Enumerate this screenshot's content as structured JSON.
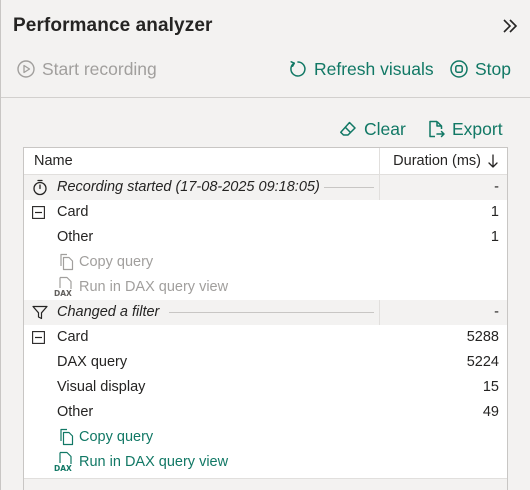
{
  "pane": {
    "title": "Performance analyzer",
    "collapse_icon": "chevron-double-right-icon"
  },
  "toolbar": {
    "start_recording": "Start recording",
    "refresh_visuals": "Refresh visuals",
    "stop": "Stop",
    "clear": "Clear",
    "export": "Export"
  },
  "colors": {
    "accent": "#117865",
    "disabled": "#a19f9d",
    "text": "#252423",
    "pane_bg": "#f3f2f1"
  },
  "table": {
    "columns": {
      "name": "Name",
      "duration": "Duration (ms)"
    },
    "sort": "descending",
    "rows": [
      {
        "type": "event",
        "icon": "stopwatch-icon",
        "label": "Recording started (17-08-2025 09:18:05)",
        "value": "-"
      },
      {
        "type": "visual",
        "icon": "collapse-box-icon",
        "label": "Card",
        "value": "1"
      },
      {
        "type": "metric",
        "label": "Other",
        "value": "1"
      },
      {
        "type": "link",
        "icon": "copy-icon",
        "label": "Copy query",
        "state": "disabled"
      },
      {
        "type": "link",
        "icon": "dax-file-icon",
        "label": "Run in DAX query view",
        "state": "disabled"
      },
      {
        "type": "event",
        "icon": "filter-icon",
        "label": "Changed a filter",
        "value": "-"
      },
      {
        "type": "visual",
        "icon": "collapse-box-icon",
        "label": "Card",
        "value": "5288"
      },
      {
        "type": "metric",
        "label": "DAX query",
        "value": "5224"
      },
      {
        "type": "metric",
        "label": "Visual display",
        "value": "15"
      },
      {
        "type": "metric",
        "label": "Other",
        "value": "49"
      },
      {
        "type": "link",
        "icon": "copy-icon",
        "label": "Copy query",
        "state": "enabled"
      },
      {
        "type": "link",
        "icon": "dax-file-icon",
        "label": "Run in DAX query view",
        "state": "enabled"
      }
    ]
  }
}
